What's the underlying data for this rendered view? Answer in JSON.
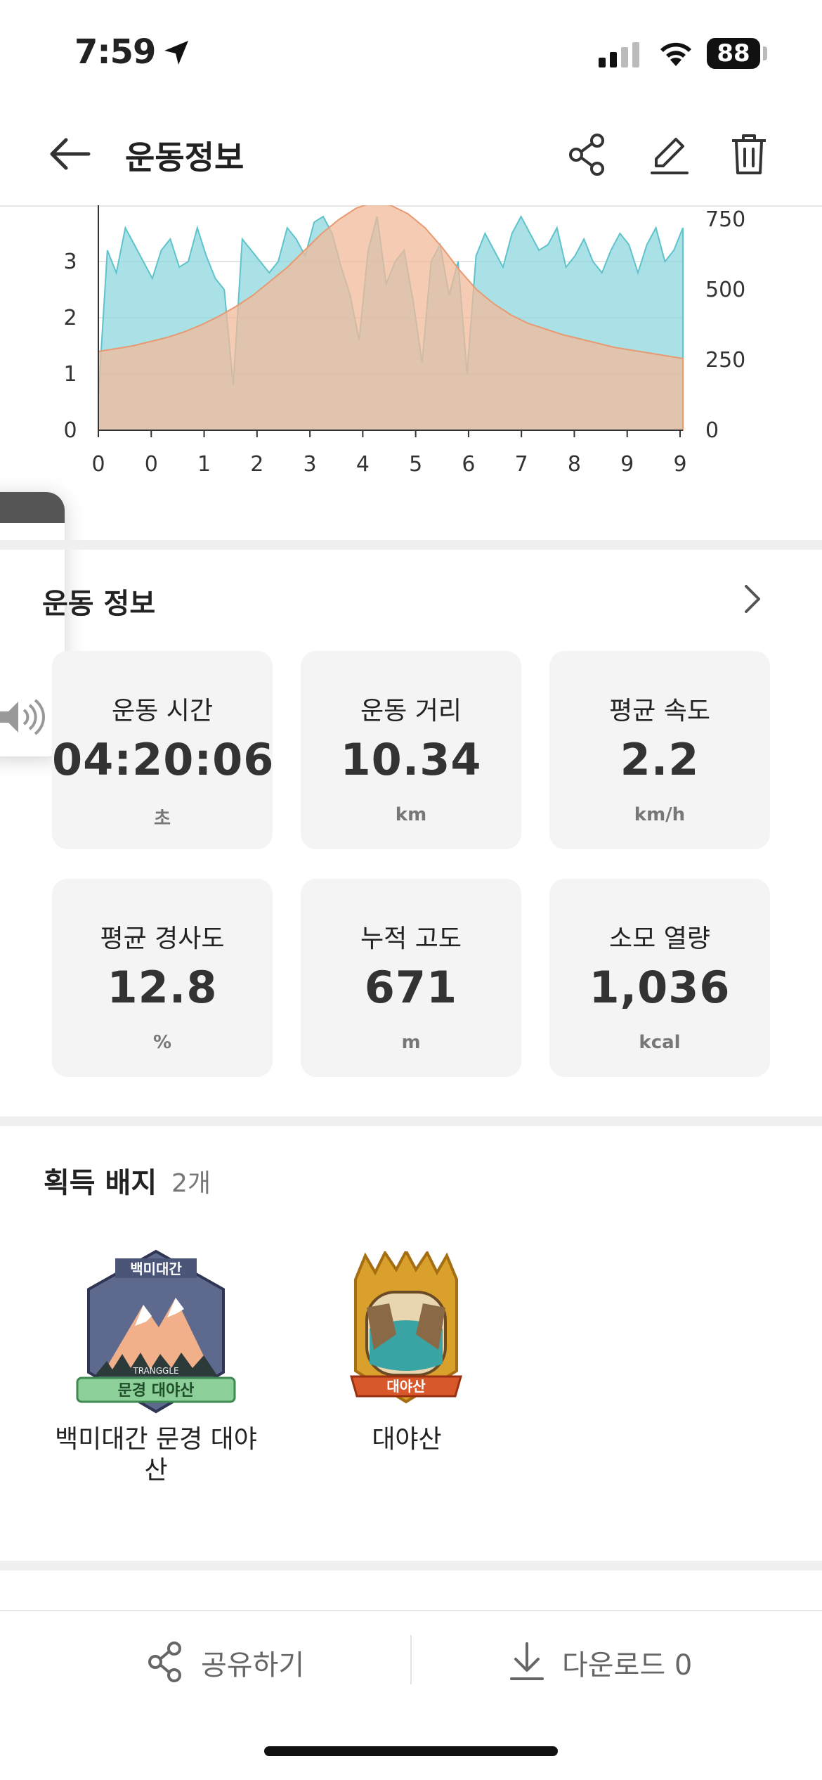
{
  "status_bar": {
    "time": "7:59",
    "battery": "88"
  },
  "header": {
    "title": "운동정보"
  },
  "chart_data": {
    "type": "area",
    "x_tick_labels": [
      "0",
      "0",
      "1",
      "2",
      "3",
      "4",
      "5",
      "6",
      "7",
      "8",
      "9",
      "9"
    ],
    "y_left_ticks": [
      "0",
      "1",
      "2",
      "3"
    ],
    "y_right_ticks": [
      "0",
      "250",
      "500",
      "750"
    ],
    "y_left_range": [
      0,
      4
    ],
    "y_right_range": [
      0,
      800
    ],
    "series": [
      {
        "axis": "left",
        "color": "#8dd7dd",
        "values": [
          0.6,
          3.2,
          2.8,
          3.6,
          3.3,
          3.0,
          2.7,
          3.2,
          3.4,
          2.9,
          3.0,
          3.6,
          3.1,
          2.7,
          2.5,
          0.8,
          3.4,
          3.2,
          3.0,
          2.8,
          3.0,
          3.6,
          3.4,
          3.1,
          3.7,
          3.8,
          3.5,
          2.9,
          2.4,
          1.6,
          3.2,
          3.8,
          2.6,
          3.0,
          3.2,
          2.3,
          1.2,
          3.0,
          3.3,
          2.4,
          3.0,
          1.0,
          3.1,
          3.5,
          3.2,
          2.9,
          3.5,
          3.8,
          3.5,
          3.2,
          3.3,
          3.6,
          2.9,
          3.1,
          3.4,
          3.0,
          2.8,
          3.2,
          3.5,
          3.3,
          2.8,
          3.3,
          3.6,
          3.0,
          3.2,
          3.6
        ]
      },
      {
        "axis": "right",
        "color": "#f3b99a",
        "values": [
          280,
          290,
          300,
          315,
          330,
          350,
          375,
          405,
          440,
          480,
          530,
          580,
          640,
          700,
          750,
          790,
          810,
          800,
          770,
          720,
          650,
          570,
          500,
          450,
          410,
          380,
          360,
          340,
          325,
          310,
          295,
          285,
          275,
          265,
          255
        ]
      }
    ],
    "grid": true
  },
  "exercise_info": {
    "title": "운동 정보",
    "cards": [
      {
        "label": "운동 시간",
        "value": "04:20:06",
        "unit": "초"
      },
      {
        "label": "운동 거리",
        "value": "10.34",
        "unit": "km"
      },
      {
        "label": "평균 속도",
        "value": "2.2",
        "unit": "km/h"
      },
      {
        "label": "평균 경사도",
        "value": "12.8",
        "unit": "%"
      },
      {
        "label": "누적 고도",
        "value": "671",
        "unit": "m"
      },
      {
        "label": "소모 열량",
        "value": "1,036",
        "unit": "kcal"
      }
    ]
  },
  "badges": {
    "title": "획득 배지",
    "count": "2개",
    "items": [
      {
        "name": "백미대간 문경 대야산",
        "banner": "문경 대야산",
        "header": "백미대간",
        "brand": "TRANGGLE"
      },
      {
        "name": "대야산",
        "banner": "대야산"
      }
    ]
  },
  "bottom_bar": {
    "share": "공유하기",
    "download": "다운로드 0"
  },
  "colors": {
    "accent_teal": "#8dd7dd",
    "accent_orange": "#f3b99a",
    "divider": "#f0f0f0"
  }
}
